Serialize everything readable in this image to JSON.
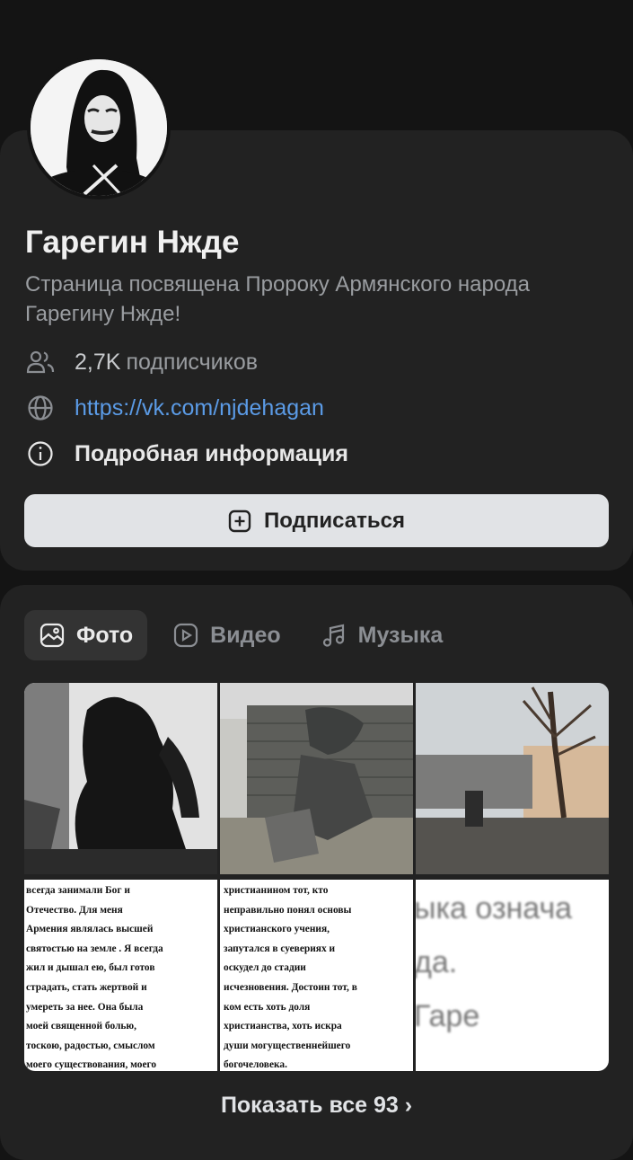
{
  "profile": {
    "name": "Гарегин Нжде",
    "description": "Страница посвящена Пророку Армянского народа Гарегину Нжде!",
    "subscribers_count": "2,7K",
    "subscribers_label": "подписчиков",
    "link": "https://vk.com/njdehagan",
    "details_label": "Подробная информация",
    "subscribe_label": "Подписаться"
  },
  "tabs": [
    {
      "label": "Фото",
      "icon": "photo-icon",
      "active": true
    },
    {
      "label": "Видео",
      "icon": "video-icon",
      "active": false
    },
    {
      "label": "Музыка",
      "icon": "music-note-icon",
      "active": false
    }
  ],
  "photos": {
    "text_4": "всегда занимали Бог и\nОтечество. Для меня\nАрмения являлась высшей\nсвятостью на земле . Я всегда\nжил и дышал ею, был готов\nстрадать, стать жертвой и\nумереть за нее. Она была\nмоей священной болью,\nтоскою, радостью, смыслом\nмоего существования, моего\nбессмертия, высшей",
    "text_5": "христианином тот, кто\nнеправильно понял основы\nхристианского учения,\nзапутался в суевериях и\nоскудел до стадии\nисчезновения. Достоин тот, в\nком есть хоть доля\nхристианства, хоть искра\nдуши могущественнейшего\nбогочеловека.",
    "text_6": "ыка означа\nда.\n             Гаре"
  },
  "show_all_label": "Показать все 93 ›",
  "colors": {
    "background": "#141414",
    "card": "#222222",
    "link": "#5b9be6",
    "button": "#e1e3e6"
  }
}
